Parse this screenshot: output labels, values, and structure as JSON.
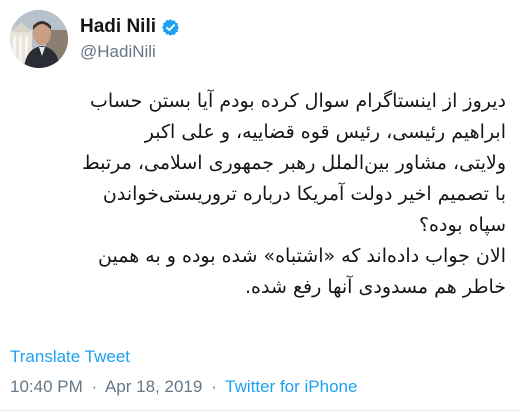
{
  "user": {
    "display_name": "Hadi Nili",
    "handle": "@HadiNili",
    "verified_icon": "verified-badge-icon",
    "avatar_icon": "profile-photo"
  },
  "tweet": {
    "lines": [
      "دیروز از اینستاگرام سوال کرده بودم آیا بستن حساب",
      "ابراهیم رئیسی، رئیس قوه قضاییه، و علی اکبر",
      "ولایتی، مشاور بین‌الملل رهبر جمهوری اسلامی، مرتبط",
      "با تصمیم اخیر دولت آمریکا درباره تروریستی‌خواندن",
      "سپاه بوده؟",
      "الان جواب داده‌اند که «اشتباه» شده بوده و به همین",
      "خاطر هم مسدودی آنها رفع شده."
    ],
    "translate_label": "Translate Tweet",
    "time": "10:40 PM",
    "date": "Apr 18, 2019",
    "separator": "·",
    "source": "Twitter for iPhone"
  },
  "colors": {
    "accent": "#1da1f2",
    "secondary_text": "#657786",
    "primary_text": "#14171a"
  }
}
